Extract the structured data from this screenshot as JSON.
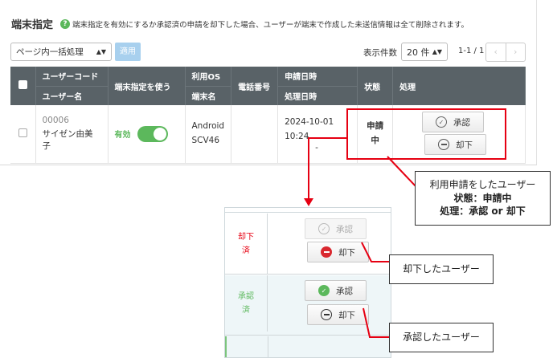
{
  "panel": {
    "title": "端末指定",
    "info_icon": "question-icon",
    "description": "端末指定を有効にするか承認済の申請を却下した場合、ユーザーが端末で作成した未送信情報は全て削除されます。"
  },
  "toolbar": {
    "bulk_select_value": "ページ内一括処理",
    "apply_label": "適用",
    "count_label": "表示件数",
    "count_value": "20 件",
    "page_info": "1-1 / 1",
    "prev_icon": "‹",
    "next_icon": "›"
  },
  "table": {
    "headers": {
      "user_code": "ユーザーコード",
      "user_name": "ユーザー名",
      "use_device": "端末指定を使う",
      "use_os": "利用OS",
      "device_name": "端末名",
      "phone": "電話番号",
      "applied_at": "申請日時",
      "processed_at": "処理日時",
      "status": "状態",
      "action": "処理"
    },
    "rows": [
      {
        "user_code": "00006",
        "user_name": "サイゼン由美子",
        "toggle_label": "有効",
        "os": "Android",
        "device": "SCV46",
        "phone": "",
        "applied_date": "2024-10-01",
        "applied_time": "10:24",
        "processed": "-",
        "status_line1": "申請",
        "status_line2": "中",
        "approve_label": "承認",
        "reject_label": "却下"
      }
    ]
  },
  "callouts": {
    "main_line1": "利用申請をしたユーザー",
    "main_line2": "状態：申請中",
    "main_line3": "処理：承認 or 却下",
    "rejected": "却下したユーザー",
    "approved": "承認したユーザー"
  },
  "examples": {
    "rejected": {
      "status_line1": "却下",
      "status_line2": "済",
      "approve_label": "承認",
      "reject_label": "却下"
    },
    "approved": {
      "status_line1": "承認",
      "status_line2": "済",
      "approve_label": "承認",
      "reject_label": "却下"
    }
  },
  "colors": {
    "header_bg": "#596267",
    "accent_green": "#5cb85c",
    "highlight_red": "#e60012",
    "apply_disabled": "#a8d0ee",
    "reject_red": "#d9282f"
  }
}
